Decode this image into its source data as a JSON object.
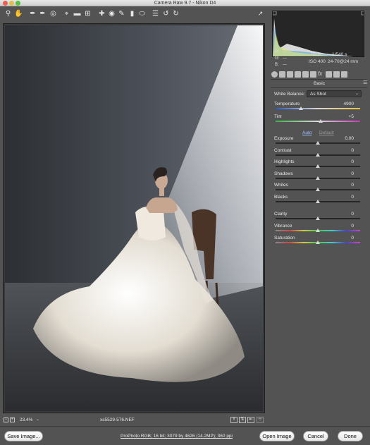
{
  "window": {
    "title": "Camera Raw 9.7  -  Nikon D4"
  },
  "histogram": {
    "r": "R:",
    "r_val": "---",
    "g": "G:",
    "g_val": "---",
    "b": "B:",
    "b_val": "---",
    "aperture": "f/5.6",
    "shutter": "1/540 s",
    "iso": "ISO 400",
    "lens": "24-70@24 mm"
  },
  "panel": {
    "section_title": "Basic",
    "white_balance_label": "White Balance:",
    "white_balance_value": "As Shot",
    "auto_label": "Auto",
    "default_label": "Default"
  },
  "sliders": [
    {
      "label": "Temperature",
      "value": "4900",
      "level": 0.3
    },
    {
      "label": "Tint",
      "value": "+5",
      "level": 0.53
    },
    {
      "label": "Exposure",
      "value": "0.00",
      "level": 0.5
    },
    {
      "label": "Contrast",
      "value": "0",
      "level": 0.5
    },
    {
      "label": "Highlights",
      "value": "0",
      "level": 0.5
    },
    {
      "label": "Shadows",
      "value": "0",
      "level": 0.5
    },
    {
      "label": "Whites",
      "value": "0",
      "level": 0.5
    },
    {
      "label": "Blacks",
      "value": "0",
      "level": 0.5
    },
    {
      "label": "Clarity",
      "value": "0",
      "level": 0.5
    },
    {
      "label": "Vibrance",
      "value": "0",
      "level": 0.5
    },
    {
      "label": "Saturation",
      "value": "0",
      "level": 0.5
    }
  ],
  "status": {
    "zoom": "23.4%",
    "filename": "xs5529-576.NEF"
  },
  "bottom": {
    "save_image": "Save Image...",
    "workflow": "ProPhoto RGB; 16 bit; 3079 by 4626 (14.2MP); 360 ppi",
    "open_image": "Open Image",
    "cancel": "Cancel",
    "done": "Done"
  }
}
